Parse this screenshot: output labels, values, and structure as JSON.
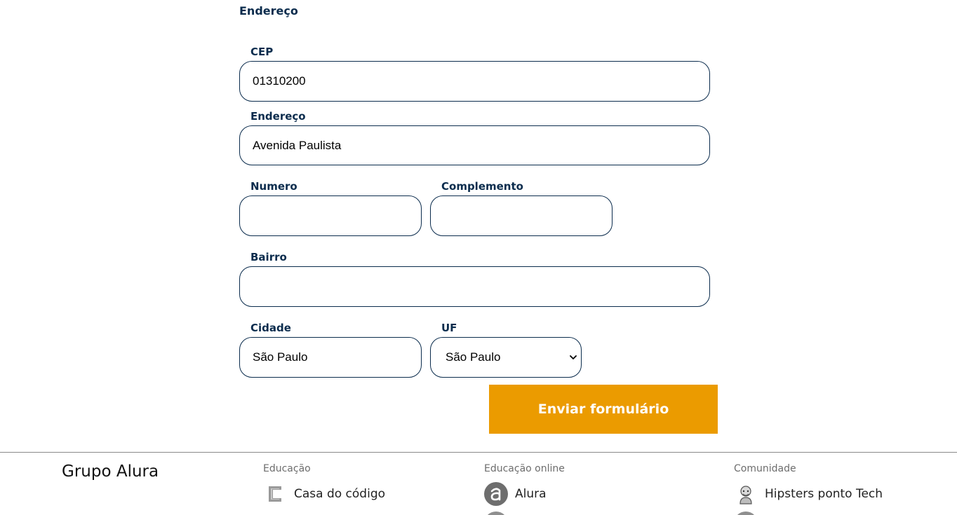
{
  "form": {
    "section_title": "Endereço",
    "cep": {
      "label": "CEP",
      "value": "01310200"
    },
    "endereco": {
      "label": "Endereço",
      "value": "Avenida Paulista"
    },
    "numero": {
      "label": "Numero",
      "value": ""
    },
    "complemento": {
      "label": "Complemento",
      "value": ""
    },
    "bairro": {
      "label": "Bairro",
      "value": ""
    },
    "cidade": {
      "label": "Cidade",
      "value": "São Paulo"
    },
    "uf": {
      "label": "UF",
      "selected": "São Paulo"
    },
    "submit_label": "Enviar formulário"
  },
  "footer": {
    "brand": "Grupo Alura",
    "columns": [
      {
        "title": "Educação",
        "link": "Casa do código",
        "icon": "casa-do-codigo-icon"
      },
      {
        "title": "Educação online",
        "link": "Alura",
        "icon": "alura-icon"
      },
      {
        "title": "Comunidade",
        "link": "Hipsters ponto Tech",
        "icon": "hipsters-icon"
      }
    ]
  },
  "colors": {
    "primary": "#0b2c4d",
    "accent": "#eb9b00"
  }
}
